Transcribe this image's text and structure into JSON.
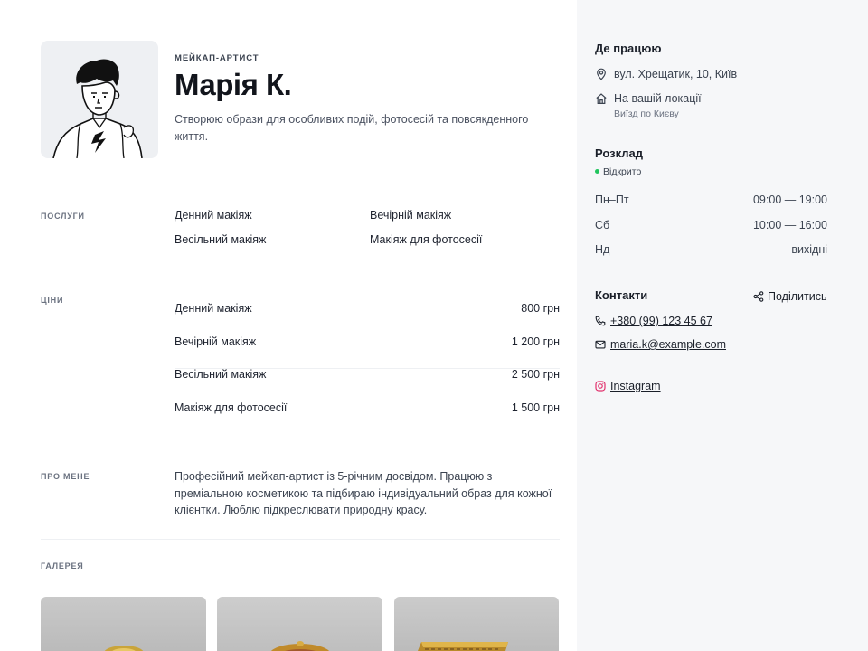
{
  "profile": {
    "role": "МЕЙКАП-АРТИСТ",
    "name": "Марія К.",
    "tagline": "Створюю образи для особливих подій, фотосесій та повсякденного життя."
  },
  "services": {
    "label": "ПОСЛУГИ",
    "items": [
      "Денний макіяж",
      "Вечірній макіяж",
      "Весільний макіяж",
      "Макіяж для фотосесії"
    ]
  },
  "prices": {
    "label": "ЦІНИ",
    "items": [
      {
        "name": "Денний макіяж",
        "price": "800 грн"
      },
      {
        "name": "Вечірній макіяж",
        "price": "1 200 грн"
      },
      {
        "name": "Весільний макіяж",
        "price": "2 500 грн"
      },
      {
        "name": "Макіяж для фотосесії",
        "price": "1 500 грн"
      }
    ]
  },
  "about": {
    "label": "ПРО МЕНЕ",
    "text": "Професійний мейкап-артист із 5-річним досвідом. Працюю з преміальною косметикою та підбираю індивідуальний образ для кожної клієнтки. Люблю підкреслювати природну красу."
  },
  "gallery": {
    "label": "ГАЛЕРЕЯ"
  },
  "location": {
    "title": "Де працюю",
    "address": "вул. Хрещатик, 10, Київ",
    "home_visit": "На вашій локації",
    "home_visit_note": "Виїзд по Києву"
  },
  "schedule": {
    "title": "Розклад",
    "status": "Відкрито",
    "rows": [
      {
        "day": "Пн–Пт",
        "time": "09:00 — 19:00"
      },
      {
        "day": "Сб",
        "time": "10:00 — 16:00"
      },
      {
        "day": "Нд",
        "time": "вихідні"
      }
    ]
  },
  "contacts": {
    "title": "Контакти",
    "share_label": "Поділитись",
    "phone": "+380 (99) 123 45 67",
    "email": "maria.k@example.com",
    "instagram": "Instagram"
  },
  "colors": {
    "status_open": "#22c55e",
    "instagram": "#e1306c",
    "sidebar_bg": "#f6f7f9"
  }
}
